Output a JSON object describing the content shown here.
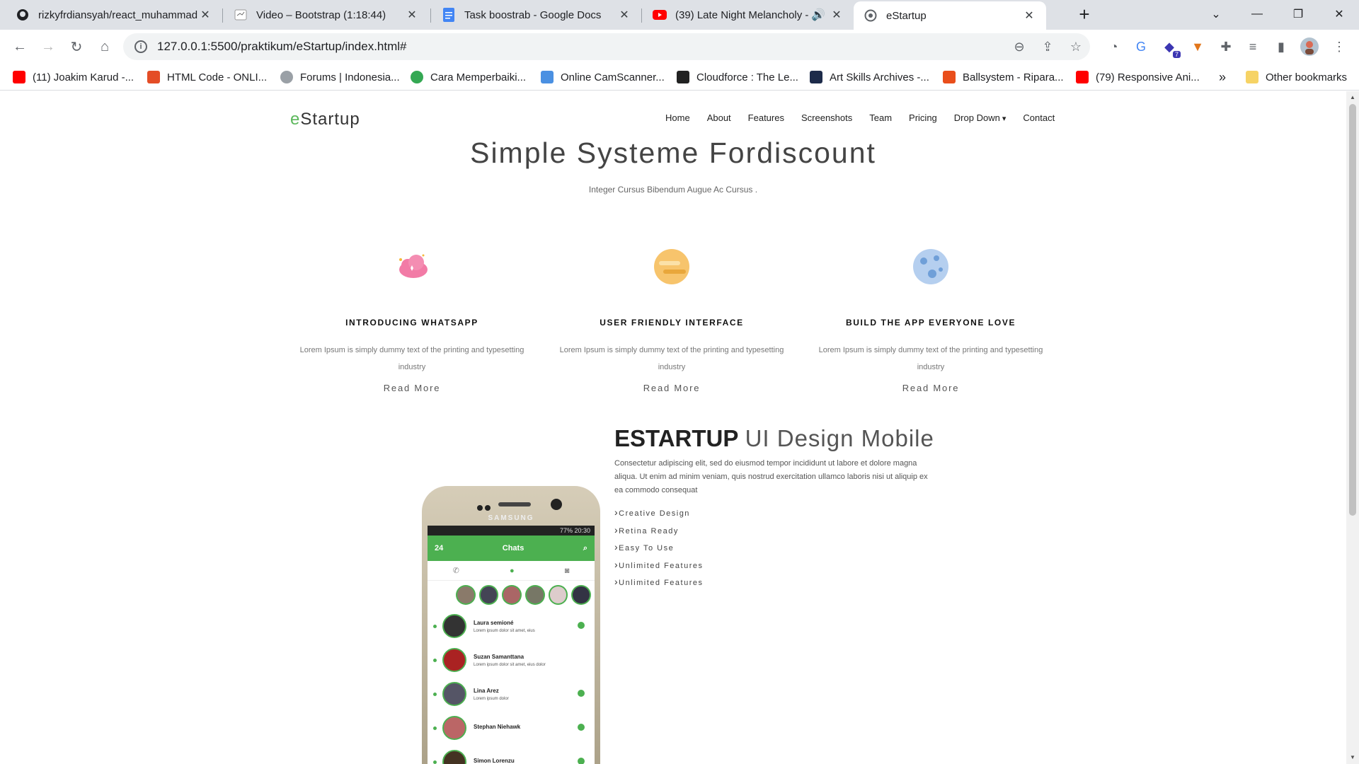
{
  "browser": {
    "tabs": [
      {
        "title": "rizkyfrdiansyah/react_muhammad",
        "favicon": "github-icon"
      },
      {
        "title": "Video – Bootstrap (1:18:44)",
        "favicon": "video-icon"
      },
      {
        "title": "Task boostrab - Google Docs",
        "favicon": "docs-icon"
      },
      {
        "title": "(39) Late Night Melancholy -",
        "favicon": "youtube-icon"
      },
      {
        "title": "eStartup",
        "favicon": "globe-icon"
      }
    ],
    "url": "127.0.0.1:5500/praktikum/eStartup/index.html#",
    "extension_badge": "7",
    "bookmarks": [
      "(11) Joakim Karud -...",
      "HTML Code - ONLI...",
      "Forums | Indonesia...",
      "Cara Memperbaiki...",
      "Online CamScanner...",
      "Cloudforce : The Le...",
      "Art Skills Archives -...",
      "Ballsystem - Ripara...",
      "(79) Responsive Ani..."
    ],
    "other_bookmarks": "Other bookmarks",
    "more_bookmarks": "»",
    "colors": {
      "accent": "#5cb85c",
      "chrome_bg": "#dee1e6"
    }
  },
  "site": {
    "brand_first": "e",
    "brand_rest": "Startup",
    "nav": [
      "Home",
      "About",
      "Features",
      "Screenshots",
      "Team",
      "Pricing",
      "Drop Down",
      "Contact"
    ],
    "hero_title": "Simple Systeme Fordiscount",
    "hero_subtitle": "Integer Cursus Bibendum Augue Ac Cursus .",
    "features": [
      {
        "title": "INTRODUCING WHATSAPP",
        "text": "Lorem Ipsum is simply dummy text of the printing and typesetting industry",
        "link": "Read More",
        "icon": "cloud-icon"
      },
      {
        "title": "USER FRIENDLY INTERFACE",
        "text": "Lorem Ipsum is simply dummy text of the printing and typesetting industry",
        "link": "Read More",
        "icon": "planet-icon"
      },
      {
        "title": "BUILD THE APP EVERYONE LOVE",
        "text": "Lorem Ipsum is simply dummy text of the printing and typesetting industry",
        "link": "Read More",
        "icon": "moon-icon"
      }
    ],
    "about": {
      "title_bold": "ESTARTUP",
      "title_light": "UI Design Mobile",
      "text": "Consectetur adipiscing elit, sed do eiusmod tempor incididunt ut labore et dolore magna aliqua. Ut enim ad minim veniam, quis nostrud exercitation ullamco laboris nisi ut aliquip ex ea commodo consequat",
      "list": [
        "Creative Design",
        "Retina Ready",
        "Easy To Use",
        "Unlimited Features",
        "Unlimited Features"
      ]
    },
    "phone": {
      "brand": "SAMSUNG",
      "status": "77% 20:30",
      "appbar_title": "Chats",
      "appbar_count": "24",
      "chats": [
        {
          "name": "Laura semioné",
          "msg": "Lorem ipsum dolor sit amet, eius"
        },
        {
          "name": "Suzan Samanttana",
          "msg": "Lorem ipsum dolor sit amet, eius dolor"
        },
        {
          "name": "Lina Arez",
          "msg": "Lorem ipsum dolor"
        },
        {
          "name": "Stephan Niehawk",
          "msg": ""
        },
        {
          "name": "Simon Lorenzu",
          "msg": ""
        }
      ]
    }
  }
}
